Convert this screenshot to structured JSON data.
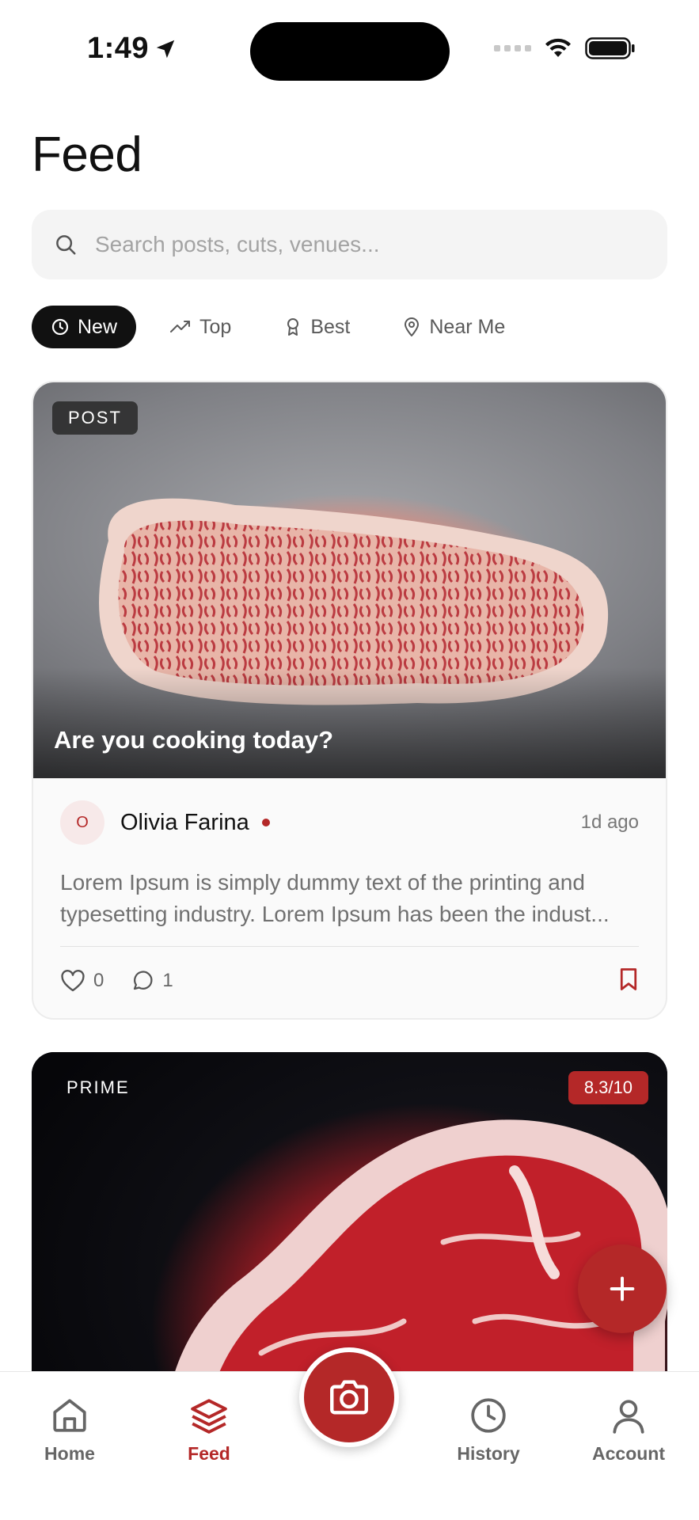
{
  "status_bar": {
    "time": "1:49"
  },
  "page": {
    "title": "Feed"
  },
  "search": {
    "placeholder": "Search posts, cuts, venues..."
  },
  "filters": [
    {
      "label": "New",
      "icon": "clock-icon",
      "active": true
    },
    {
      "label": "Top",
      "icon": "trending-up-icon",
      "active": false
    },
    {
      "label": "Best",
      "icon": "award-icon",
      "active": false
    },
    {
      "label": "Near Me",
      "icon": "map-pin-icon",
      "active": false
    }
  ],
  "posts": [
    {
      "badge": "POST",
      "caption": "Are you cooking today?",
      "author_initial": "O",
      "author": "Olivia Farina",
      "time": "1d ago",
      "text": "Lorem Ipsum is simply dummy text of the printing and typesetting industry. Lorem Ipsum has been the indust...",
      "likes": "0",
      "comments": "1"
    },
    {
      "badge": "PRIME",
      "score": "8.3/10"
    }
  ],
  "nav": {
    "home": "Home",
    "feed": "Feed",
    "history": "History",
    "account": "Account"
  },
  "colors": {
    "accent": "#b42828",
    "active_tab_bg": "#111111"
  }
}
